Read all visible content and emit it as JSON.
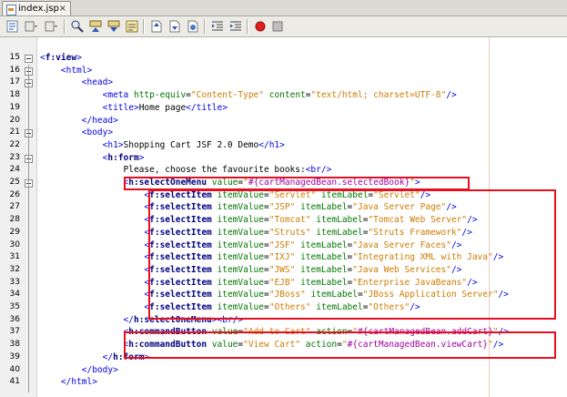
{
  "tab": {
    "title": "index.jsp",
    "close": "×"
  },
  "toolbar": {
    "icons": [
      "source-view-icon",
      "history-icon",
      "back-icon",
      "forward-icon",
      "find-icon",
      "find-previous-icon",
      "find-next-icon",
      "toggle-highlight-icon",
      "prev-bookmark-icon",
      "next-bookmark-icon",
      "toggle-bookmark-icon",
      "shift-left-icon",
      "shift-right-icon",
      "record-macro-icon",
      "stop-macro-icon"
    ]
  },
  "lines": [
    {
      "n": "15",
      "segs": [
        [
          "tag",
          "<"
        ],
        [
          "btag",
          "f:view"
        ],
        [
          "tag",
          ">"
        ]
      ]
    },
    {
      "n": "16",
      "segs": [
        [
          "",
          "    "
        ],
        [
          "tag",
          "<html>"
        ]
      ]
    },
    {
      "n": "17",
      "segs": [
        [
          "",
          "        "
        ],
        [
          "tag",
          "<head>"
        ]
      ]
    },
    {
      "n": "18",
      "segs": [
        [
          "",
          "            "
        ],
        [
          "tag",
          "<meta "
        ],
        [
          "attr",
          "http-equiv"
        ],
        [
          "",
          "="
        ],
        [
          "val",
          "\"Content-Type\""
        ],
        [
          "",
          " "
        ],
        [
          "attr",
          "content"
        ],
        [
          "",
          "="
        ],
        [
          "val",
          "\"text/html; charset=UTF-8\""
        ],
        [
          "tag",
          "/>"
        ]
      ]
    },
    {
      "n": "19",
      "segs": [
        [
          "",
          "            "
        ],
        [
          "tag",
          "<title>"
        ],
        [
          "",
          "Home page"
        ],
        [
          "tag",
          "</title>"
        ]
      ]
    },
    {
      "n": "20",
      "segs": [
        [
          "",
          "        "
        ],
        [
          "tag",
          "</head>"
        ]
      ]
    },
    {
      "n": "21",
      "segs": [
        [
          "",
          "        "
        ],
        [
          "tag",
          "<body>"
        ]
      ]
    },
    {
      "n": "22",
      "segs": [
        [
          "",
          "            "
        ],
        [
          "tag",
          "<h1>"
        ],
        [
          "",
          "Shopping Cart JSF 2.0 Demo"
        ],
        [
          "tag",
          "</h1>"
        ]
      ]
    },
    {
      "n": "23",
      "segs": [
        [
          "",
          "            "
        ],
        [
          "tag",
          "<"
        ],
        [
          "btag",
          "h:form"
        ],
        [
          "tag",
          ">"
        ]
      ]
    },
    {
      "n": "24",
      "segs": [
        [
          "",
          "                Please, choose the favourite books:"
        ],
        [
          "tag",
          "<br/>"
        ]
      ]
    },
    {
      "n": "25",
      "segs": [
        [
          "",
          "                "
        ],
        [
          "tag",
          "<"
        ],
        [
          "btag",
          "h:selectOneMenu"
        ],
        [
          "",
          " "
        ],
        [
          "attr",
          "value"
        ],
        [
          "",
          "="
        ],
        [
          "val",
          "\""
        ],
        [
          "el",
          "#{cartManagedBean.selectedBook}"
        ],
        [
          "val",
          "\""
        ],
        [
          "tag",
          ">"
        ]
      ]
    },
    {
      "n": "26",
      "segs": [
        [
          "",
          "                    "
        ],
        [
          "tag",
          "<"
        ],
        [
          "btag",
          "f:selectItem"
        ],
        [
          "",
          " "
        ],
        [
          "attr",
          "itemValue"
        ],
        [
          "",
          "="
        ],
        [
          "val",
          "\"Servlet\""
        ],
        [
          "",
          " "
        ],
        [
          "attr",
          "itemLabel"
        ],
        [
          "",
          "="
        ],
        [
          "val",
          "\"Servlet\""
        ],
        [
          "tag",
          "/>"
        ]
      ]
    },
    {
      "n": "27",
      "segs": [
        [
          "",
          "                    "
        ],
        [
          "tag",
          "<"
        ],
        [
          "btag",
          "f:selectItem"
        ],
        [
          "",
          " "
        ],
        [
          "attr",
          "itemValue"
        ],
        [
          "",
          "="
        ],
        [
          "val",
          "\"JSP\""
        ],
        [
          "",
          " "
        ],
        [
          "attr",
          "itemLabel"
        ],
        [
          "",
          "="
        ],
        [
          "val",
          "\"Java Server Page\""
        ],
        [
          "tag",
          "/>"
        ]
      ]
    },
    {
      "n": "28",
      "segs": [
        [
          "",
          "                    "
        ],
        [
          "tag",
          "<"
        ],
        [
          "btag",
          "f:selectItem"
        ],
        [
          "",
          " "
        ],
        [
          "attr",
          "itemValue"
        ],
        [
          "",
          "="
        ],
        [
          "val",
          "\"Tomcat\""
        ],
        [
          "",
          " "
        ],
        [
          "attr",
          "itemLabel"
        ],
        [
          "",
          "="
        ],
        [
          "val",
          "\"Tomcat Web Server\""
        ],
        [
          "tag",
          "/>"
        ]
      ]
    },
    {
      "n": "29",
      "segs": [
        [
          "",
          "                    "
        ],
        [
          "tag",
          "<"
        ],
        [
          "btag",
          "f:selectItem"
        ],
        [
          "",
          " "
        ],
        [
          "attr",
          "itemValue"
        ],
        [
          "",
          "="
        ],
        [
          "val",
          "\"Struts\""
        ],
        [
          "",
          " "
        ],
        [
          "attr",
          "itemLabel"
        ],
        [
          "",
          "="
        ],
        [
          "val",
          "\"Struts Framework\""
        ],
        [
          "tag",
          "/>"
        ]
      ]
    },
    {
      "n": "30",
      "segs": [
        [
          "",
          "                    "
        ],
        [
          "tag",
          "<"
        ],
        [
          "btag",
          "f:selectItem"
        ],
        [
          "",
          " "
        ],
        [
          "attr",
          "itemValue"
        ],
        [
          "",
          "="
        ],
        [
          "val",
          "\"JSF\""
        ],
        [
          "",
          " "
        ],
        [
          "attr",
          "itemLabel"
        ],
        [
          "",
          "="
        ],
        [
          "val",
          "\"Java Server Faces\""
        ],
        [
          "tag",
          "/>"
        ]
      ]
    },
    {
      "n": "31",
      "segs": [
        [
          "",
          "                    "
        ],
        [
          "tag",
          "<"
        ],
        [
          "btag",
          "f:selectItem"
        ],
        [
          "",
          " "
        ],
        [
          "attr",
          "itemValue"
        ],
        [
          "",
          "="
        ],
        [
          "val",
          "\"IXJ\""
        ],
        [
          "",
          " "
        ],
        [
          "attr",
          "itemLabel"
        ],
        [
          "",
          "="
        ],
        [
          "val",
          "\"Integrating XML with Java\""
        ],
        [
          "tag",
          "/>"
        ]
      ]
    },
    {
      "n": "32",
      "segs": [
        [
          "",
          "                    "
        ],
        [
          "tag",
          "<"
        ],
        [
          "btag",
          "f:selectItem"
        ],
        [
          "",
          " "
        ],
        [
          "attr",
          "itemValue"
        ],
        [
          "",
          "="
        ],
        [
          "val",
          "\"JWS\""
        ],
        [
          "",
          " "
        ],
        [
          "attr",
          "itemLabel"
        ],
        [
          "",
          "="
        ],
        [
          "val",
          "\"Java Web Services\""
        ],
        [
          "tag",
          "/>"
        ]
      ]
    },
    {
      "n": "33",
      "segs": [
        [
          "",
          "                    "
        ],
        [
          "tag",
          "<"
        ],
        [
          "btag",
          "f:selectItem"
        ],
        [
          "",
          " "
        ],
        [
          "attr",
          "itemValue"
        ],
        [
          "",
          "="
        ],
        [
          "val",
          "\"EJB\""
        ],
        [
          "",
          " "
        ],
        [
          "attr",
          "itemLabel"
        ],
        [
          "",
          "="
        ],
        [
          "val",
          "\"Enterprise JavaBeans\""
        ],
        [
          "tag",
          "/>"
        ]
      ]
    },
    {
      "n": "34",
      "segs": [
        [
          "",
          "                    "
        ],
        [
          "tag",
          "<"
        ],
        [
          "btag",
          "f:selectItem"
        ],
        [
          "",
          " "
        ],
        [
          "attr",
          "itemValue"
        ],
        [
          "",
          "="
        ],
        [
          "val",
          "\"JBoss\""
        ],
        [
          "",
          " "
        ],
        [
          "attr",
          "itemLabel"
        ],
        [
          "",
          "="
        ],
        [
          "val",
          "\"JBoss Application Server\""
        ],
        [
          "tag",
          "/>"
        ]
      ]
    },
    {
      "n": "35",
      "segs": [
        [
          "",
          "                    "
        ],
        [
          "tag",
          "<"
        ],
        [
          "btag",
          "f:selectItem"
        ],
        [
          "",
          " "
        ],
        [
          "attr",
          "itemValue"
        ],
        [
          "",
          "="
        ],
        [
          "val",
          "\"Others\""
        ],
        [
          "",
          " "
        ],
        [
          "attr",
          "itemLabel"
        ],
        [
          "",
          "="
        ],
        [
          "val",
          "\"Others\""
        ],
        [
          "tag",
          "/>"
        ]
      ]
    },
    {
      "n": "36",
      "segs": [
        [
          "",
          "                "
        ],
        [
          "tag",
          "</"
        ],
        [
          "btag",
          "h:selectOneMenu"
        ],
        [
          "tag",
          ">"
        ],
        [
          "tag",
          "<br/>"
        ]
      ]
    },
    {
      "n": "37",
      "segs": [
        [
          "",
          "                "
        ],
        [
          "tag",
          "<"
        ],
        [
          "btag",
          "h:commandButton"
        ],
        [
          "",
          " "
        ],
        [
          "attr",
          "value"
        ],
        [
          "",
          "="
        ],
        [
          "val",
          "\"Add to Cart\""
        ],
        [
          "",
          " "
        ],
        [
          "attr",
          "action"
        ],
        [
          "",
          "="
        ],
        [
          "val",
          "\""
        ],
        [
          "el",
          "#{cartManagedBean.addCart}"
        ],
        [
          "val",
          "\""
        ],
        [
          "tag",
          "/>"
        ]
      ]
    },
    {
      "n": "38",
      "segs": [
        [
          "",
          "                "
        ],
        [
          "tag",
          "<"
        ],
        [
          "btag",
          "h:commandButton"
        ],
        [
          "",
          " "
        ],
        [
          "attr",
          "value"
        ],
        [
          "",
          "="
        ],
        [
          "val",
          "\"View Cart\""
        ],
        [
          "",
          " "
        ],
        [
          "attr",
          "action"
        ],
        [
          "",
          "="
        ],
        [
          "val",
          "\""
        ],
        [
          "el",
          "#{cartManagedBean.viewCart}"
        ],
        [
          "val",
          "\""
        ],
        [
          "tag",
          "/>"
        ]
      ]
    },
    {
      "n": "39",
      "segs": [
        [
          "",
          "            "
        ],
        [
          "tag",
          "</"
        ],
        [
          "btag",
          "h:form"
        ],
        [
          "tag",
          ">"
        ]
      ]
    },
    {
      "n": "40",
      "segs": [
        [
          "",
          "        "
        ],
        [
          "tag",
          "</body>"
        ]
      ]
    },
    {
      "n": "41",
      "segs": [
        [
          "",
          "    "
        ],
        [
          "tag",
          "</html>"
        ]
      ]
    }
  ]
}
